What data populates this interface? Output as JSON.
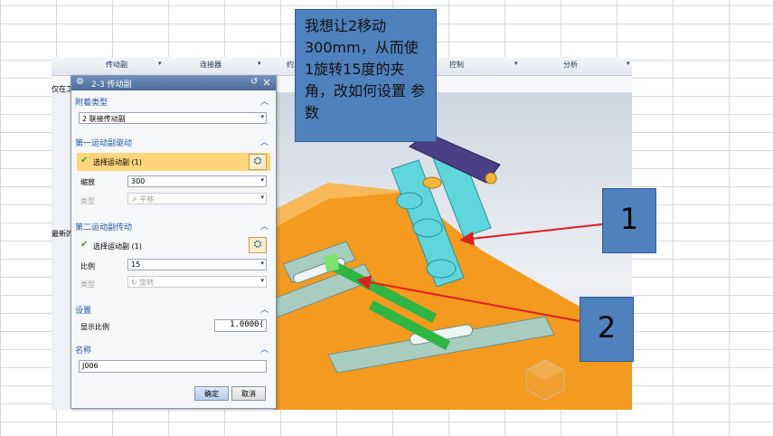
{
  "cad": {
    "ribbon_groups": [
      "传动副",
      "连接器",
      "约束",
      "控制",
      "分析"
    ],
    "side_labels": [
      "仅在工",
      "最新的"
    ]
  },
  "dialog": {
    "title": "2-3 传动副",
    "attach_type": {
      "header": "附着类型",
      "value": "2 联接传动副"
    },
    "first_drive": {
      "header": "第一运动副驱动",
      "select_label": "选择运动副 (1)",
      "scale_label": "缩放",
      "scale_value": "300",
      "type_label": "类型",
      "type_value": "平移"
    },
    "second_drive": {
      "header": "第二运动副传动",
      "select_label": "选择运动副 (1)",
      "ratio_label": "比例",
      "ratio_value": "15",
      "type_label": "类型",
      "type_value": "旋转"
    },
    "settings": {
      "header": "设置",
      "display_ratio_label": "显示比例",
      "display_ratio_value": "1.0000("
    },
    "name_section": {
      "header": "名称",
      "value": "J006"
    },
    "ok_label": "确定",
    "cancel_label": "取消"
  },
  "annotation": {
    "question": "我想让2移动300mm，从而使1旋转15度的夹角，改如何设置 参数",
    "label_1": "1",
    "label_2": "2"
  },
  "colors": {
    "dialog_title": "#4a6c98",
    "highlight_row": "#fdd57a",
    "note_fill": "#4f81bd",
    "arrow": "#e02020",
    "part_cyan": "#5fd6dc",
    "base_orange": "#f39a1f"
  }
}
